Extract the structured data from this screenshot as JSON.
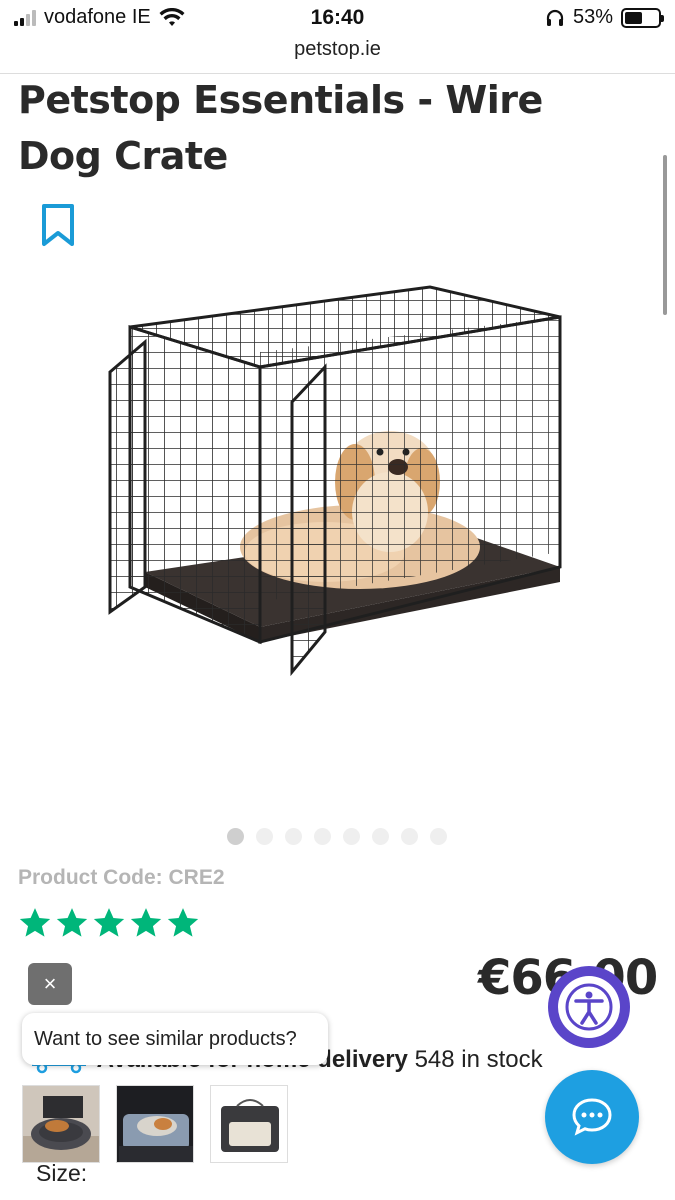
{
  "status_bar": {
    "carrier": "vodafone IE",
    "time": "16:40",
    "battery_percent": "53%",
    "battery_level": 0.53
  },
  "browser": {
    "url": "petstop.ie"
  },
  "product": {
    "title": "Petstop Essentials - Wire Dog Crate",
    "code_label": "Product Code: CRE2",
    "rating_stars": 5,
    "price": "€66.00",
    "image_count": 8,
    "active_image_index": 0
  },
  "similar": {
    "close_label": "×",
    "prompt": "Want to see similar products?"
  },
  "delivery": {
    "text": "Available for home delivery",
    "stock": "548 in stock"
  },
  "options": {
    "size_label": "Size:"
  },
  "colors": {
    "rating_green": "#00b67a",
    "accent_blue": "#1e9fe1",
    "accessibility_purple": "#5a45c9",
    "bookmark_blue": "#1a9bd7"
  }
}
